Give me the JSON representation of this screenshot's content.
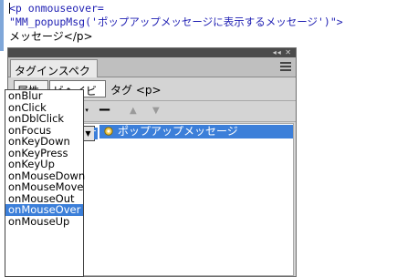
{
  "code": {
    "line1_prefix": "<p onmouseover=",
    "line2": "\"MM_popupMsg('ポップアップメッセージに表示するメッセージ')\">",
    "line3": "メッセージ</p>"
  },
  "panel": {
    "title_buttons": "◂◂ ✕",
    "tab_label": "タグインスペクター",
    "subtabs": {
      "attributes": "属性",
      "behaviors": "ビヘイビアー"
    },
    "tag_label": "タグ <p>",
    "toolbar": {
      "add": "+",
      "add_arrow": "▾",
      "remove": "−",
      "up": "▲",
      "down": "▼"
    }
  },
  "behavior": {
    "event_value": "onMouseOver",
    "action_label": "ポップアップメッセージ"
  },
  "dropdown": {
    "options": [
      "onBlur",
      "onClick",
      "onDblClick",
      "onFocus",
      "onKeyDown",
      "onKeyPress",
      "onKeyUp",
      "onMouseDown",
      "onMouseMove",
      "onMouseOut",
      "onMouseOver",
      "onMouseUp"
    ],
    "selected": "onMouseOver"
  },
  "colors": {
    "selection": "#3c7fd9",
    "panel_bg": "#d4d4d4",
    "titlebar": "#4b4b4b"
  }
}
